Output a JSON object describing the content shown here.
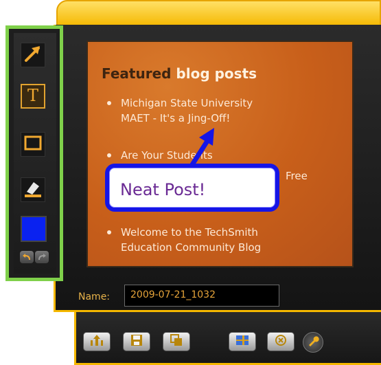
{
  "capture": {
    "title_part1": "Featured ",
    "title_part2": "blog posts",
    "items": [
      {
        "line1": "Michigan State University",
        "line2": "MAET - It's a Jing-Off!"
      },
      {
        "line1": "Are Your Students",
        "line2": ""
      },
      {
        "line1": "Free",
        "line2": ""
      },
      {
        "line1": "Welcome to the TechSmith",
        "line2": "Education Community Blog"
      }
    ]
  },
  "callout": {
    "text": "Neat Post!"
  },
  "name_field": {
    "label": "Name:",
    "value": "2009-07-21_1032"
  },
  "colors": {
    "accent": "#f5b800",
    "highlight_box": "#7fd04a",
    "selected_color": "#0a22f0",
    "callout_border": "#1515e6",
    "callout_text": "#6a2a94"
  },
  "toolbar_left": {
    "tools": [
      "arrow-icon",
      "text-icon",
      "rectangle-icon",
      "highlighter-icon"
    ],
    "selected_tool": "text-icon"
  },
  "bottom_toolbar": {
    "buttons": [
      "share-icon",
      "save-icon",
      "copy-icon",
      "flash-icon",
      "cancel-icon",
      "settings-icon"
    ]
  }
}
